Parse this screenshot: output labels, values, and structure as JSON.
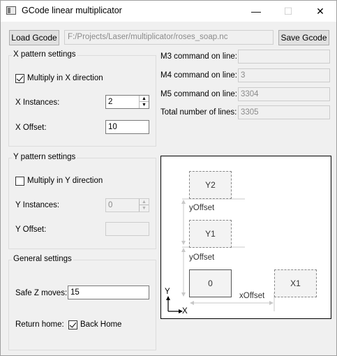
{
  "window": {
    "title": "GCode linear multiplicator",
    "minimize_glyph": "—",
    "maximize_glyph": "☐",
    "close_glyph": "✕"
  },
  "toolbar": {
    "load_label": "Load Gcode",
    "file_path": "F:/Projects/Laser/multiplicator/roses_soap.nc",
    "save_label": "Save Gcode"
  },
  "x_group": {
    "title": "X pattern settings",
    "multiply_label": "Multiply in X direction",
    "multiply_checked": true,
    "instances_label": "X Instances:",
    "instances_value": "2",
    "offset_label": "X Offset:",
    "offset_value": "10"
  },
  "info": {
    "m3_label": "M3 command on line:",
    "m3_value": "",
    "m4_label": "M4 command on line:",
    "m4_value": "3",
    "m5_label": "M5 command on line:",
    "m5_value": "3304",
    "total_label": "Total number of lines:",
    "total_value": "3305"
  },
  "y_group": {
    "title": "Y pattern settings",
    "multiply_label": "Multiply in Y direction",
    "multiply_checked": false,
    "instances_label": "Y Instances:",
    "instances_value": "0",
    "offset_label": "Y Offset:",
    "offset_value": ""
  },
  "general": {
    "title": "General settings",
    "safe_z_label": "Safe Z moves:",
    "safe_z_value": "15",
    "return_home_label": "Return home:",
    "back_home_label": "Back Home",
    "back_home_checked": true
  },
  "diagram": {
    "box_y2": "Y2",
    "box_y1": "Y1",
    "box_0": "0",
    "box_x1": "X1",
    "y_offset_top": "yOffset",
    "y_offset_bottom": "yOffset",
    "x_offset": "xOffset",
    "axis_y": "Y",
    "axis_x": "X"
  }
}
